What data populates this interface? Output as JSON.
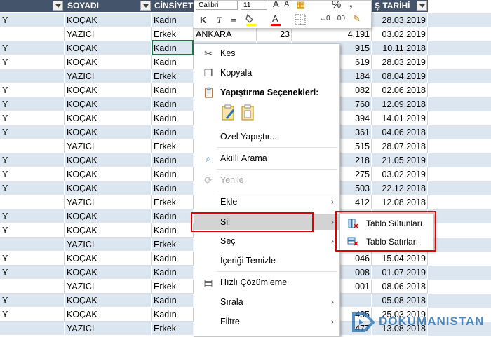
{
  "headers": {
    "soyadi": "SOYADI",
    "cinsiyet": "CİNSİYET",
    "tarih": "Ş TARİHİ"
  },
  "rows": [
    {
      "a": "Y",
      "soyadi": "KOÇAK",
      "cinsiyet": "Kadın",
      "n1": "",
      "n2": "",
      "n3": "",
      "date": "28.03.2019",
      "alt": true
    },
    {
      "a": "",
      "soyadi": "YAZICI",
      "cinsiyet": "Erkek",
      "n1": "ANKARA",
      "n2": "23",
      "n3": "4.191",
      "date": "03.02.2019",
      "alt": false
    },
    {
      "a": "Y",
      "soyadi": "KOÇAK",
      "cinsiyet": "Kadın",
      "n1": "",
      "n2": "",
      "n3": "915",
      "date": "10.11.2018",
      "alt": true
    },
    {
      "a": "Y",
      "soyadi": "KOÇAK",
      "cinsiyet": "Kadın",
      "n1": "",
      "n2": "",
      "n3": "619",
      "date": "28.03.2019",
      "alt": false
    },
    {
      "a": "",
      "soyadi": "YAZICI",
      "cinsiyet": "Erkek",
      "n1": "",
      "n2": "",
      "n3": "184",
      "date": "08.04.2019",
      "alt": true
    },
    {
      "a": "Y",
      "soyadi": "KOÇAK",
      "cinsiyet": "Kadın",
      "n1": "",
      "n2": "",
      "n3": "082",
      "date": "02.06.2018",
      "alt": false
    },
    {
      "a": "Y",
      "soyadi": "KOÇAK",
      "cinsiyet": "Kadın",
      "n1": "",
      "n2": "",
      "n3": "760",
      "date": "12.09.2018",
      "alt": true
    },
    {
      "a": "Y",
      "soyadi": "KOÇAK",
      "cinsiyet": "Kadın",
      "n1": "",
      "n2": "",
      "n3": "394",
      "date": "14.01.2019",
      "alt": false
    },
    {
      "a": "Y",
      "soyadi": "KOÇAK",
      "cinsiyet": "Kadın",
      "n1": "",
      "n2": "",
      "n3": "361",
      "date": "04.06.2018",
      "alt": true
    },
    {
      "a": "",
      "soyadi": "YAZICI",
      "cinsiyet": "Erkek",
      "n1": "",
      "n2": "",
      "n3": "515",
      "date": "28.07.2018",
      "alt": false
    },
    {
      "a": "Y",
      "soyadi": "KOÇAK",
      "cinsiyet": "Kadın",
      "n1": "",
      "n2": "",
      "n3": "218",
      "date": "21.05.2019",
      "alt": true
    },
    {
      "a": "Y",
      "soyadi": "KOÇAK",
      "cinsiyet": "Kadın",
      "n1": "",
      "n2": "",
      "n3": "275",
      "date": "03.02.2019",
      "alt": false
    },
    {
      "a": "Y",
      "soyadi": "KOÇAK",
      "cinsiyet": "Kadın",
      "n1": "",
      "n2": "",
      "n3": "503",
      "date": "22.12.2018",
      "alt": true
    },
    {
      "a": "",
      "soyadi": "YAZICI",
      "cinsiyet": "Erkek",
      "n1": "",
      "n2": "",
      "n3": "412",
      "date": "12.08.2018",
      "alt": false
    },
    {
      "a": "Y",
      "soyadi": "KOÇAK",
      "cinsiyet": "Kadın",
      "n1": "",
      "n2": "",
      "n3": "",
      "date": "",
      "alt": true
    },
    {
      "a": "Y",
      "soyadi": "KOÇAK",
      "cinsiyet": "Kadın",
      "n1": "",
      "n2": "",
      "n3": "",
      "date": "",
      "alt": false
    },
    {
      "a": "",
      "soyadi": "YAZICI",
      "cinsiyet": "Erkek",
      "n1": "",
      "n2": "",
      "n3": "",
      "date": "",
      "alt": true
    },
    {
      "a": "Y",
      "soyadi": "KOÇAK",
      "cinsiyet": "Kadın",
      "n1": "",
      "n2": "",
      "n3": "046",
      "date": "15.04.2019",
      "alt": false
    },
    {
      "a": "Y",
      "soyadi": "KOÇAK",
      "cinsiyet": "Kadın",
      "n1": "",
      "n2": "",
      "n3": "008",
      "date": "01.07.2019",
      "alt": true
    },
    {
      "a": "",
      "soyadi": "YAZICI",
      "cinsiyet": "Erkek",
      "n1": "",
      "n2": "",
      "n3": "001",
      "date": "08.06.2018",
      "alt": false
    },
    {
      "a": "Y",
      "soyadi": "KOÇAK",
      "cinsiyet": "Kadın",
      "n1": "",
      "n2": "",
      "n3": "",
      "date": "05.08.2018",
      "alt": true
    },
    {
      "a": "Y",
      "soyadi": "KOÇAK",
      "cinsiyet": "Kadın",
      "n1": "",
      "n2": "",
      "n3": "435",
      "date": "25.03.2019",
      "alt": false
    },
    {
      "a": "",
      "soyadi": "YAZICI",
      "cinsiyet": "Erkek",
      "n1": "",
      "n2": "",
      "n3": "477",
      "date": "13.08.2018",
      "alt": true
    }
  ],
  "mini_toolbar": {
    "font": "Calibri",
    "size": "11",
    "grow": "A",
    "shrink": "A",
    "percent": "%",
    "comma": ",",
    "bold": "K",
    "italic": "T",
    "align": "≡"
  },
  "menu": {
    "kes": "Kes",
    "kopyala": "Kopyala",
    "yapistirma": "Yapıştırma Seçenekleri:",
    "ozel": "Özel Yapıştır...",
    "akilli": "Akıllı Arama",
    "yenile": "Yenile",
    "ekle": "Ekle",
    "sil": "Sil",
    "sec": "Seç",
    "temizle": "İçeriği Temizle",
    "hizli": "Hızlı Çözümleme",
    "sirala": "Sırala",
    "filtre": "Filtre"
  },
  "submenu": {
    "sutun": "Tablo Sütunları",
    "satir": "Tablo Satırları"
  },
  "watermark": "DOKUMANISTAN",
  "accent": "#217346",
  "highlight_color": "#e00000"
}
